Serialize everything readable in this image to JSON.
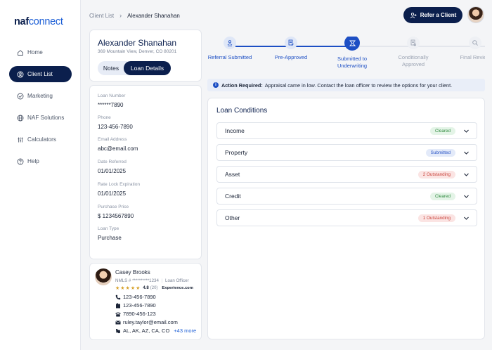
{
  "brand": {
    "logo_part1": "naf",
    "logo_part2": "connect"
  },
  "sidebar": {
    "items": [
      {
        "label": "Home",
        "icon": "home-icon"
      },
      {
        "label": "Client List",
        "icon": "user-circle-icon"
      },
      {
        "label": "Marketing",
        "icon": "check-circle-icon"
      },
      {
        "label": "NAF Solutions",
        "icon": "globe-icon"
      },
      {
        "label": "Calculators",
        "icon": "calculator-icon"
      },
      {
        "label": "Help",
        "icon": "help-icon"
      }
    ],
    "active_index": 1
  },
  "breadcrumb": {
    "parent": "Client List",
    "separator": "›",
    "current": "Alexander Shanahan"
  },
  "header": {
    "refer_button": "Refer a Client"
  },
  "client": {
    "name": "Alexander Shanahan",
    "address": "369 Mountain View, Denver, CO 80201",
    "tabs": {
      "notes": "Notes",
      "loan_details": "Loan Details"
    }
  },
  "details": [
    {
      "label": "Loan Number",
      "value": "******7890"
    },
    {
      "label": "Phone",
      "value": "123-456-7890"
    },
    {
      "label": "Email Address",
      "value": "abc@email.com"
    },
    {
      "label": "Date Referred",
      "value": "01/01/2025"
    },
    {
      "label": "Rate Lock Expiration",
      "value": "01/01/2025"
    },
    {
      "label": "Purchase Price",
      "value": "$ 1234567890"
    },
    {
      "label": "Loan Type",
      "value": "Purchase"
    }
  ],
  "officer": {
    "name": "Casey Brooks",
    "nmls": "NMLS # **********1234",
    "role": "Loan Officer",
    "stars": "★★★★★",
    "score": "4.8",
    "reviews": "(20)",
    "experience": "Experience.com",
    "phone_mobile": "123-456-7890",
    "phone_office": "123-456-7890",
    "phone_fax": "7890-456-123",
    "email": "ruley.taylor@email.com",
    "states": "AL, AK, AZ, CA, CO",
    "more_states": "+43 more"
  },
  "stepper": {
    "steps": [
      {
        "label": "Referral Submitted",
        "label2": "",
        "state": "done"
      },
      {
        "label": "Pre-Approved",
        "label2": "",
        "state": "done"
      },
      {
        "label": "Submitted to",
        "label2": "Underwriting",
        "state": "current"
      },
      {
        "label": "Conditionally",
        "label2": "Approved",
        "state": "pending"
      },
      {
        "label": "Final Review",
        "label2": "",
        "state": "pending"
      }
    ]
  },
  "alert": {
    "title": "Action Required:",
    "message": "Appraisal came in low. Contact the loan officer to review the options for your client."
  },
  "conditions": {
    "title": "Loan Conditions",
    "rows": [
      {
        "name": "Income",
        "status": "Cleared",
        "kind": "cleared"
      },
      {
        "name": "Property",
        "status": "Submitted",
        "kind": "submitted"
      },
      {
        "name": "Asset",
        "status": "2 Outstanding",
        "kind": "outstanding"
      },
      {
        "name": "Credit",
        "status": "Cleared",
        "kind": "cleared"
      },
      {
        "name": "Other",
        "status": "1 Outstanding",
        "kind": "outstanding"
      }
    ]
  },
  "colors": {
    "navy": "#0b1f4d",
    "accent_blue": "#1d4fc4",
    "cleared": "#2e8a3e",
    "outstanding": "#c9433b"
  }
}
